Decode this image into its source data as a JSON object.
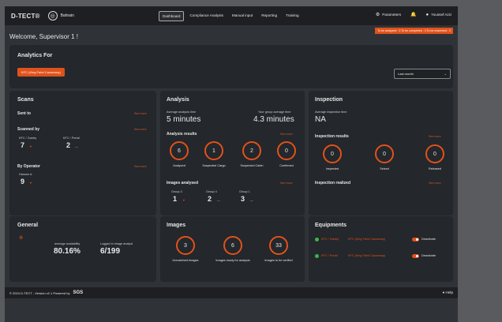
{
  "app": {
    "logo": "D-TECT®",
    "country": "Bahrain",
    "nav": [
      {
        "label": "Dashboard",
        "active": true
      },
      {
        "label": "Compliance Analysis"
      },
      {
        "label": "Manual input"
      },
      {
        "label": "Reporting"
      },
      {
        "label": "Training"
      }
    ],
    "parameters_label": "Parameters",
    "user_name": "Youssef Azzi",
    "welcome": "Welcome, Supervisor 1 !",
    "status_bar": "To be analyzed : 3   To be completed : 3   To be examined : 3"
  },
  "analytics": {
    "title": "Analytics For",
    "site_button": "KFC (King Fahd Causeway)",
    "period_select": "Last month"
  },
  "scans": {
    "title": "Scans",
    "sent_to": "Sent to",
    "scanned_by": "Scanned by",
    "by_operator": "By Operator",
    "see_more": "See more",
    "gantry_label": "KFC / Gantry",
    "gantry_value": "7",
    "gantry_trend": "▼",
    "portal_label": "KFC / Portal",
    "portal_value": "2",
    "portal_trend": "—",
    "operator_label": "Hassan A.",
    "operator_value": "9",
    "operator_trend": "▼"
  },
  "analysis": {
    "title": "Analysis",
    "avg_time_label": "Average analysis time",
    "avg_time_value": "5 minutes",
    "group_avg_label": "Your group average time",
    "group_avg_value": "4.3 minutes",
    "results_label": "Analysis results",
    "see_more": "See more",
    "results": [
      {
        "value": "6",
        "label": "Analyzed"
      },
      {
        "value": "1",
        "label": "Suspected Cargo"
      },
      {
        "value": "2",
        "label": "Suspected Cabin"
      },
      {
        "value": "0",
        "label": "Confirmed"
      }
    ],
    "images_analysed_label": "Images analysed",
    "groups": [
      {
        "label": "Group 3",
        "value": "1",
        "trend": "▼"
      },
      {
        "label": "Group 4",
        "value": "2",
        "trend": "—"
      },
      {
        "label": "Group 1",
        "value": "3",
        "trend": "—"
      }
    ]
  },
  "inspection": {
    "title": "Inspection",
    "avg_time_label": "Average inspection time",
    "avg_time_value": "NA",
    "results_label": "Inspection results",
    "see_more": "See more",
    "results": [
      {
        "value": "0",
        "label": "Inspected"
      },
      {
        "value": "0",
        "label": "Seized"
      },
      {
        "value": "0",
        "label": "Released"
      }
    ],
    "realized_label": "Inspection realized"
  },
  "general": {
    "title": "General",
    "availability_label": "average availability",
    "availability_value": "80.16%",
    "logged_label": "Logged in image analyst",
    "logged_value": "6/199"
  },
  "images": {
    "title": "Images",
    "items": [
      {
        "value": "3",
        "label": "Unmatched Images"
      },
      {
        "value": "6",
        "label": "Images ready for analysis"
      },
      {
        "value": "33",
        "label": "Images to be verified"
      }
    ]
  },
  "equipments": {
    "title": "Equipments",
    "items": [
      {
        "name": "KFC / Gantry",
        "site": "KFC (King Fahd Causeway)",
        "action": "Deactivate"
      },
      {
        "name": "KFC / Portal",
        "site": "KFC (King Fahd Causeway)",
        "action": "Deactivate"
      }
    ]
  },
  "footer": {
    "copyright": "© 2024 D-TECT - Version v2.1 Powered by",
    "brand": "SGS",
    "help": "Help"
  },
  "colors": {
    "accent": "#e0521b",
    "background": "#2f3236",
    "panel": "#24272b",
    "topbar": "#1e1f22",
    "active_dot": "#3cb44a"
  }
}
